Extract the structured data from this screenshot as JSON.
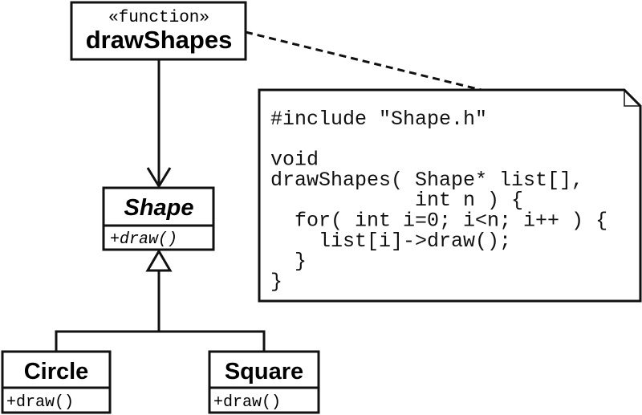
{
  "function_box": {
    "stereotype": "«function»",
    "name": "drawShapes"
  },
  "shape_class": {
    "name": "Shape",
    "operation": "+draw()"
  },
  "circle_class": {
    "name": "Circle",
    "operation": "+draw()"
  },
  "square_class": {
    "name": "Square",
    "operation": "+draw()"
  },
  "note": {
    "lines": [
      "#include \"Shape.h\"",
      "",
      "void",
      "drawShapes( Shape* list[],",
      "            int n ) {",
      "  for( int i=0; i<n; i++ ) {",
      "    list[i]->draw();",
      "  }",
      "}"
    ]
  }
}
